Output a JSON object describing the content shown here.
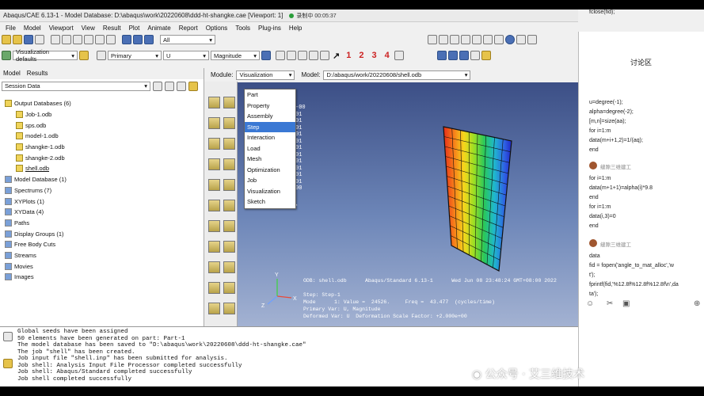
{
  "window": {
    "title": "Abaqus/CAE 6.13-1 - Model Database: D:\\abaqus\\work\\20220608\\ddd-ht-shangke.cae [Viewport: 1]",
    "recorder": "录制中 00:05:37"
  },
  "menu": [
    "File",
    "Model",
    "Viewport",
    "View",
    "Result",
    "Plot",
    "Animate",
    "Report",
    "Options",
    "Tools",
    "Plug-ins",
    "Help"
  ],
  "toolbar": {
    "all_label": "All",
    "viz_defaults": "Visualization defaults",
    "primary": "Primary",
    "variable": "U",
    "magnitude": "Magnitude",
    "step_numbers": [
      "1",
      "2",
      "3",
      "4"
    ]
  },
  "left": {
    "tabs": [
      "Model",
      "Results"
    ],
    "session_data": "Session Data",
    "tree": [
      {
        "label": "Output Databases (6)",
        "level": 0
      },
      {
        "label": "Job-1.odb",
        "level": 1
      },
      {
        "label": "sps.odb",
        "level": 1
      },
      {
        "label": "model-1.odb",
        "level": 1
      },
      {
        "label": "shangke-1.odb",
        "level": 1
      },
      {
        "label": "shangke-2.odb",
        "level": 1
      },
      {
        "label": "shell.odb",
        "level": 1
      },
      {
        "label": "Model Database (1)",
        "level": 0
      },
      {
        "label": "Spectrums (7)",
        "level": 0
      },
      {
        "label": "XYPlots (1)",
        "level": 0
      },
      {
        "label": "XYData (4)",
        "level": 0
      },
      {
        "label": "Paths",
        "level": 0
      },
      {
        "label": "Display Groups (1)",
        "level": 0
      },
      {
        "label": "Free Body Cuts",
        "level": 0
      },
      {
        "label": "Streams",
        "level": 0
      },
      {
        "label": "Movies",
        "level": 0
      },
      {
        "label": "Images",
        "level": 0
      }
    ]
  },
  "context": {
    "module_label": "Module:",
    "module_value": "Visualization",
    "model_label": "Model:",
    "model_value": "D:/abaqus/work/20220608/shell.odb"
  },
  "module_options": [
    "Part",
    "Property",
    "Assembly",
    "Step",
    "Interaction",
    "Load",
    "Mesh",
    "Optimization",
    "Job",
    "Visualization",
    "Sketch"
  ],
  "module_highlight": "Step",
  "legend_values": [
    "-00",
    "01",
    "01",
    "01",
    "01",
    "01",
    "01",
    "01",
    "01",
    "01",
    "01",
    "01",
    "00"
  ],
  "viewport_info": [
    "ODB: shell.odb      Abaqus/Standard 6.13-1      Wed Jun 08 23:48:24 GMT+08:00 2022",
    "",
    "Step: Step-1",
    "Mode      1: Value =  24526.     Freq =  43.477  (cycles/time)",
    "Primary Var: U, Magnitude",
    "Deformed Var: U  Deformation Scale Factor: +2.000e+00"
  ],
  "messages": [
    "Global seeds have been assigned",
    "50 elements have been generated on part: Part-1",
    "The model database has been saved to \"D:\\abaqus\\work\\20220608\\ddd-ht-shangke.cae\"",
    "The job \"shell\" has been created.",
    "Job input file \"shell.inp\" has been submitted for analysis.",
    "Job shell: Analysis Input File Processor completed successfully",
    "Job shell: Abaqus/Standard completed successfully",
    "Job shell completed successfully"
  ],
  "chat": {
    "title": "讨论区",
    "lines": [
      "u=degree(-1);",
      "alpha=degree(-2);",
      "[m,n]=size(aa);",
      "for i=1:m",
      "data(m+i+1,2)=1/(aq);",
      "end",
      "for i=1:m",
      "data(m+1+1)=alpha(i)*9.8",
      "end",
      "for i=1:m",
      "data(i,3)=0",
      "end",
      "data",
      "fid = fopen('angle_to_mat_alloc','w",
      "t');",
      "fprintf(fid,'%12.8f%12.8f%12.8f\\n',da",
      "ta');",
      "fclose(fid);"
    ],
    "user": "缝隙三维建工"
  },
  "watermark": "公众号 · 艾三维技术",
  "colors": {
    "accent": "#3a78d4",
    "viewport_top": "#3c4f86",
    "viewport_bottom": "#a3b2d2"
  }
}
